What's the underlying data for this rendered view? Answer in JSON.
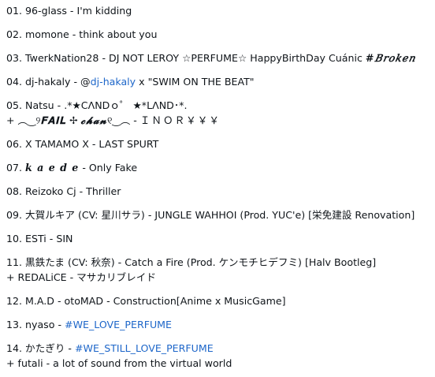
{
  "tracks": [
    {
      "lines": [
        [
          {
            "t": "01. 96-glass - I'm kidding"
          }
        ]
      ]
    },
    {
      "lines": [
        [
          {
            "t": "02. momone - think about you"
          }
        ]
      ]
    },
    {
      "lines": [
        [
          {
            "t": "03. TwerkNation28 - DJ NOT LEROY ☆PERFUME☆ HappyBirthDay Cuánic "
          },
          {
            "t": "#𝐵𝑟𝑜𝑘𝑒𝑛",
            "style": "fancy"
          }
        ]
      ]
    },
    {
      "lines": [
        [
          {
            "t": "04. dj-hakaly - @"
          },
          {
            "t": "dj-hakaly",
            "style": "link"
          },
          {
            "t": " x \"SWIM ON THE BEAT\""
          }
        ]
      ]
    },
    {
      "lines": [
        [
          {
            "t": "05. Natsu - .*★CΛNDｏ゜ ★*LΛND･*."
          }
        ],
        [
          {
            "t": "+ ︵‿୨"
          },
          {
            "t": "𝐅𝐀𝐈𝐋",
            "style": "fancy"
          },
          {
            "t": " ✢ "
          },
          {
            "t": "𝓬𝓱𝓪𝓷",
            "style": "fancy"
          },
          {
            "t": "୧‿︵ - "
          },
          {
            "t": "ＩＮＯＲ￥￥￥",
            "style": "spaced"
          }
        ]
      ]
    },
    {
      "lines": [
        [
          {
            "t": "06. X TAMAMO X - LAST SPURT"
          }
        ]
      ]
    },
    {
      "lines": [
        [
          {
            "t": "07. "
          },
          {
            "t": "𝒌 𝒂 𝒆 𝒅 𝒆",
            "style": "fancy"
          },
          {
            "t": " - Only Fake"
          }
        ]
      ]
    },
    {
      "lines": [
        [
          {
            "t": "08. Reizoko Cj - Thriller"
          }
        ]
      ]
    },
    {
      "lines": [
        [
          {
            "t": "09. 大賀ルキア (CV: 星川サラ) - JUNGLE WAHHOI (Prod. YUC'e) [栄免建設 Renovation]"
          }
        ]
      ]
    },
    {
      "lines": [
        [
          {
            "t": "10. ESTi - SIN"
          }
        ]
      ]
    },
    {
      "lines": [
        [
          {
            "t": "11. 黒鉄たま (CV: 秋奈) - Catch a Fire (Prod. ケンモチヒデフミ) [Halv Bootleg]"
          }
        ],
        [
          {
            "t": "+ REDALiCE - マサカリブレイド"
          }
        ]
      ]
    },
    {
      "lines": [
        [
          {
            "t": "12. M.A.D - otoMAD - Construction[Anime x MusicGame]"
          }
        ]
      ]
    },
    {
      "lines": [
        [
          {
            "t": "13. nyaso - "
          },
          {
            "t": "#WE_LOVE_PERFUME",
            "style": "link"
          }
        ]
      ]
    },
    {
      "lines": [
        [
          {
            "t": "14. かたぎり - "
          },
          {
            "t": "#WE_STILL_LOVE_PERFUME",
            "style": "link"
          }
        ],
        [
          {
            "t": "+ futali - a lot of sound from the virtual world"
          }
        ]
      ]
    }
  ]
}
